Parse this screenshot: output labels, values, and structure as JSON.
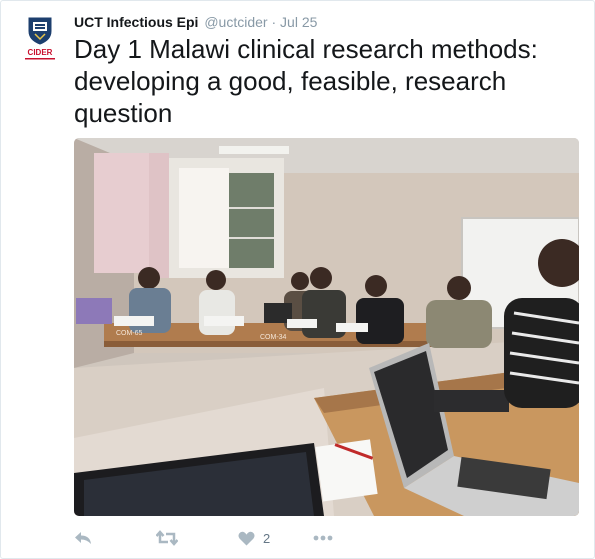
{
  "tweet": {
    "author_name": "UCT Infectious Epi",
    "handle": "@uctcider",
    "separator": "·",
    "date": "Jul 25",
    "text": "Day 1 Malawi clinical research methods: developing a good, feasible, research question",
    "avatar_label": "CIDER",
    "photo_desk_labels": [
      "COM-65",
      "COM-34"
    ]
  },
  "actions": {
    "reply_icon": "reply-icon",
    "retweet_icon": "retweet-icon",
    "like_icon": "heart-icon",
    "like_count": "2",
    "more_icon": "more-dots-icon"
  },
  "colors": {
    "text": "#14171a",
    "muted": "#8899a6",
    "action_icons": "#aab8c2",
    "border": "#e1e8ed",
    "cider_red": "#c8102e"
  }
}
